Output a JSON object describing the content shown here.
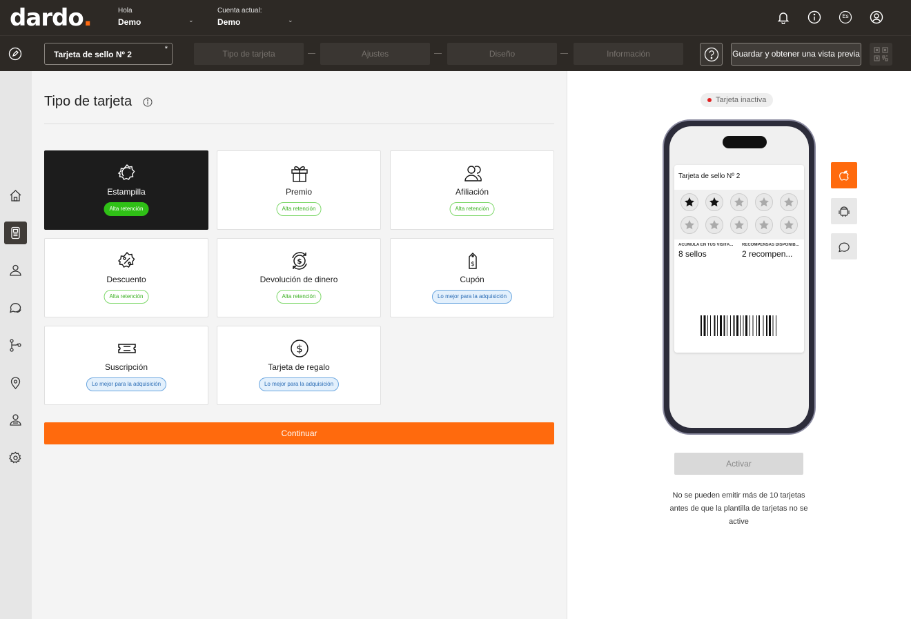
{
  "header": {
    "logo_text": "dardo",
    "logo_dot": ".",
    "greeting_label": "Hola",
    "greeting_value": "Demo",
    "account_label": "Cuenta actual:",
    "account_value": "Demo",
    "language": "Es"
  },
  "stepbar": {
    "card_name": "Tarjeta de sello Nº 2",
    "required_mark": "*",
    "steps": [
      "Tipo de tarjeta",
      "Ajustes",
      "Diseño",
      "Información"
    ],
    "save_label": "Guardar y obtener una vista previa"
  },
  "main": {
    "title": "Tipo de tarjeta",
    "card_types": [
      {
        "name": "Estampilla",
        "badge": "Alta retención",
        "badge_type": "green",
        "icon": "stamp-icon",
        "selected": true
      },
      {
        "name": "Premio",
        "badge": "Alta retención",
        "badge_type": "green",
        "icon": "gift-icon"
      },
      {
        "name": "Afiliación",
        "badge": "Alta retención",
        "badge_type": "green",
        "icon": "members-icon"
      },
      {
        "name": "Descuento",
        "badge": "Alta retención",
        "badge_type": "green",
        "icon": "discount-icon"
      },
      {
        "name": "Devolución de dinero",
        "badge": "Alta retención",
        "badge_type": "green",
        "icon": "cashback-icon"
      },
      {
        "name": "Cupón",
        "badge": "Lo mejor para la adquisición",
        "badge_type": "blue",
        "icon": "coupon-icon"
      },
      {
        "name": "Suscripción",
        "badge": "Lo mejor para la adquisición",
        "badge_type": "blue",
        "icon": "ticket-icon"
      },
      {
        "name": "Tarjeta de regalo",
        "badge": "Lo mejor para la adquisición",
        "badge_type": "blue",
        "icon": "dollar-icon"
      }
    ],
    "continue_label": "Continuar"
  },
  "preview": {
    "status": "Tarjeta inactiva",
    "pass_title": "Tarjeta de sello Nº 2",
    "stamps_total": 10,
    "stamps_filled": 2,
    "field1_label": "ACUMULA EN TUS VISITA...",
    "field1_value": "8 sellos",
    "field2_label": "RECOMPENSAS DISPONIB...",
    "field2_value": "2 recompen...",
    "activate_label": "Activar",
    "notice": "No se pueden emitir más de 10 tarjetas antes de que la plantilla de tarjetas no se active"
  },
  "colors": {
    "accent": "#ff6a0d",
    "topbar": "#2d2925",
    "badge_green": "#2fc016",
    "badge_blue": "#2a6cb5",
    "inactive_dot": "#e02020"
  }
}
